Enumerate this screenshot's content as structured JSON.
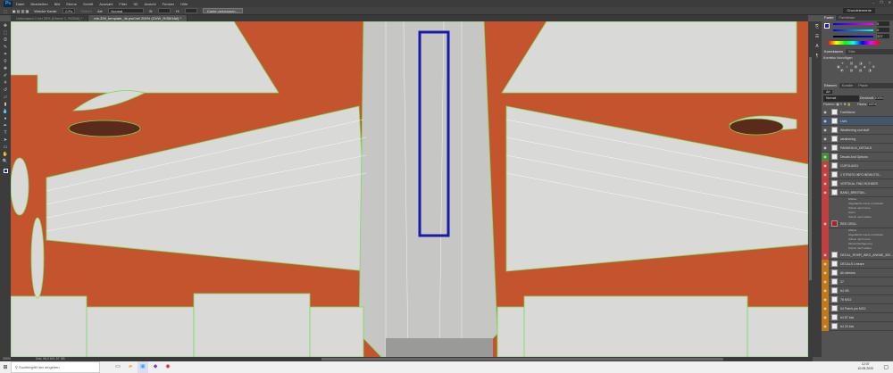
{
  "menubar": {
    "logo": "Ps",
    "items": [
      "Datei",
      "Bearbeiten",
      "Bild",
      "Ebene",
      "Schrift",
      "Auswahl",
      "Filter",
      "3D",
      "Ansicht",
      "Fenster",
      "Hilfe"
    ],
    "window_controls": [
      "–",
      "❐",
      "✕"
    ]
  },
  "options": {
    "feather_label": "Weiche Kante:",
    "feather_value": "0 Px",
    "smooth": "Glätten",
    "style_label": "Art:",
    "style_value": "Normal",
    "w_label": "B:",
    "h_label": "H:",
    "refine_button": "Kante verbessern...",
    "workspace": "Grundelemente"
  },
  "tabs": [
    {
      "label": "Unbenannt-1 bei 25% (Ebene 1, RGB/8) *"
    },
    {
      "label": "mb-339_template_4k.psd bei 200% (GVW_RGB/16#) *"
    }
  ],
  "status": {
    "zoom": "200%",
    "doc": "Dok: 96,0 M/1,57 GB"
  },
  "panels": {
    "color_tabs": [
      "Farbe",
      "Farbfelder"
    ],
    "color_values": [
      "0",
      "0",
      "207"
    ],
    "adjust_tabs": [
      "Korrekturen",
      "Stile"
    ],
    "adjust_title": "Korrektur hinzufügen",
    "layer_tabs": [
      "Ebenen",
      "Kanäle",
      "Pfade"
    ],
    "kind": "Art",
    "blend": "Normal",
    "opacity_label": "Deckkraft:",
    "opacity": "100%",
    "lock_label": "Fixieren:",
    "fill_label": "Fläche:",
    "fill": "100%",
    "layers": [
      {
        "name": "Farbfläche",
        "type": ""
      },
      {
        "name": "Licht",
        "type": "sel"
      },
      {
        "name": "Weathering und stuff",
        "type": ""
      },
      {
        "name": "weathering",
        "type": ""
      },
      {
        "name": "PANNEAUX_DETAILS",
        "type": ""
      },
      {
        "name": "Decals And Options",
        "type": "grn"
      },
      {
        "name": "CUPOLA001",
        "type": "red"
      },
      {
        "name": "2 STRATO INFO BEWUTIG...",
        "type": "red"
      },
      {
        "name": "VERTIKAL FIND ROHDER",
        "type": "red"
      },
      {
        "name": "BAND_BREITAN...",
        "type": "red"
      }
    ],
    "fx1": [
      "Effekte",
      "Abgeflachte Kante und Relief",
      "Schein nach innen",
      "Glanz",
      "Schein nach außen"
    ],
    "layer_red": "RED GRILL",
    "fx2": [
      "Effekte",
      "Abgeflachte Kante und Relief",
      "Schein nach innen",
      "Musterüberlagerung",
      "Schein nach außen"
    ],
    "layers2": [
      {
        "name": "DECAL_ROHR_WEG_ANHAE_300...",
        "type": "red"
      },
      {
        "name": "DECALS Lineare",
        "type": "org"
      },
      {
        "name": "Ah sternes",
        "type": "org"
      },
      {
        "name": "37",
        "type": "org"
      },
      {
        "name": "64 VB",
        "type": "org"
      },
      {
        "name": "76 MG2",
        "type": "org"
      },
      {
        "name": "64 Patch pro MG2",
        "type": "org"
      },
      {
        "name": "64 87 lots",
        "type": "org"
      },
      {
        "name": "64 20 lots",
        "type": "org"
      }
    ]
  },
  "taskbar": {
    "search_placeholder": "Suchbegriff hier eingeben",
    "time": "12:07",
    "date": "10.05.2020"
  },
  "colors": {
    "canvas_orange": "#c4542d",
    "panel_white": "#d8d8d6",
    "selection_blue": "#1a1aa8",
    "wire_green": "#7ed957"
  }
}
